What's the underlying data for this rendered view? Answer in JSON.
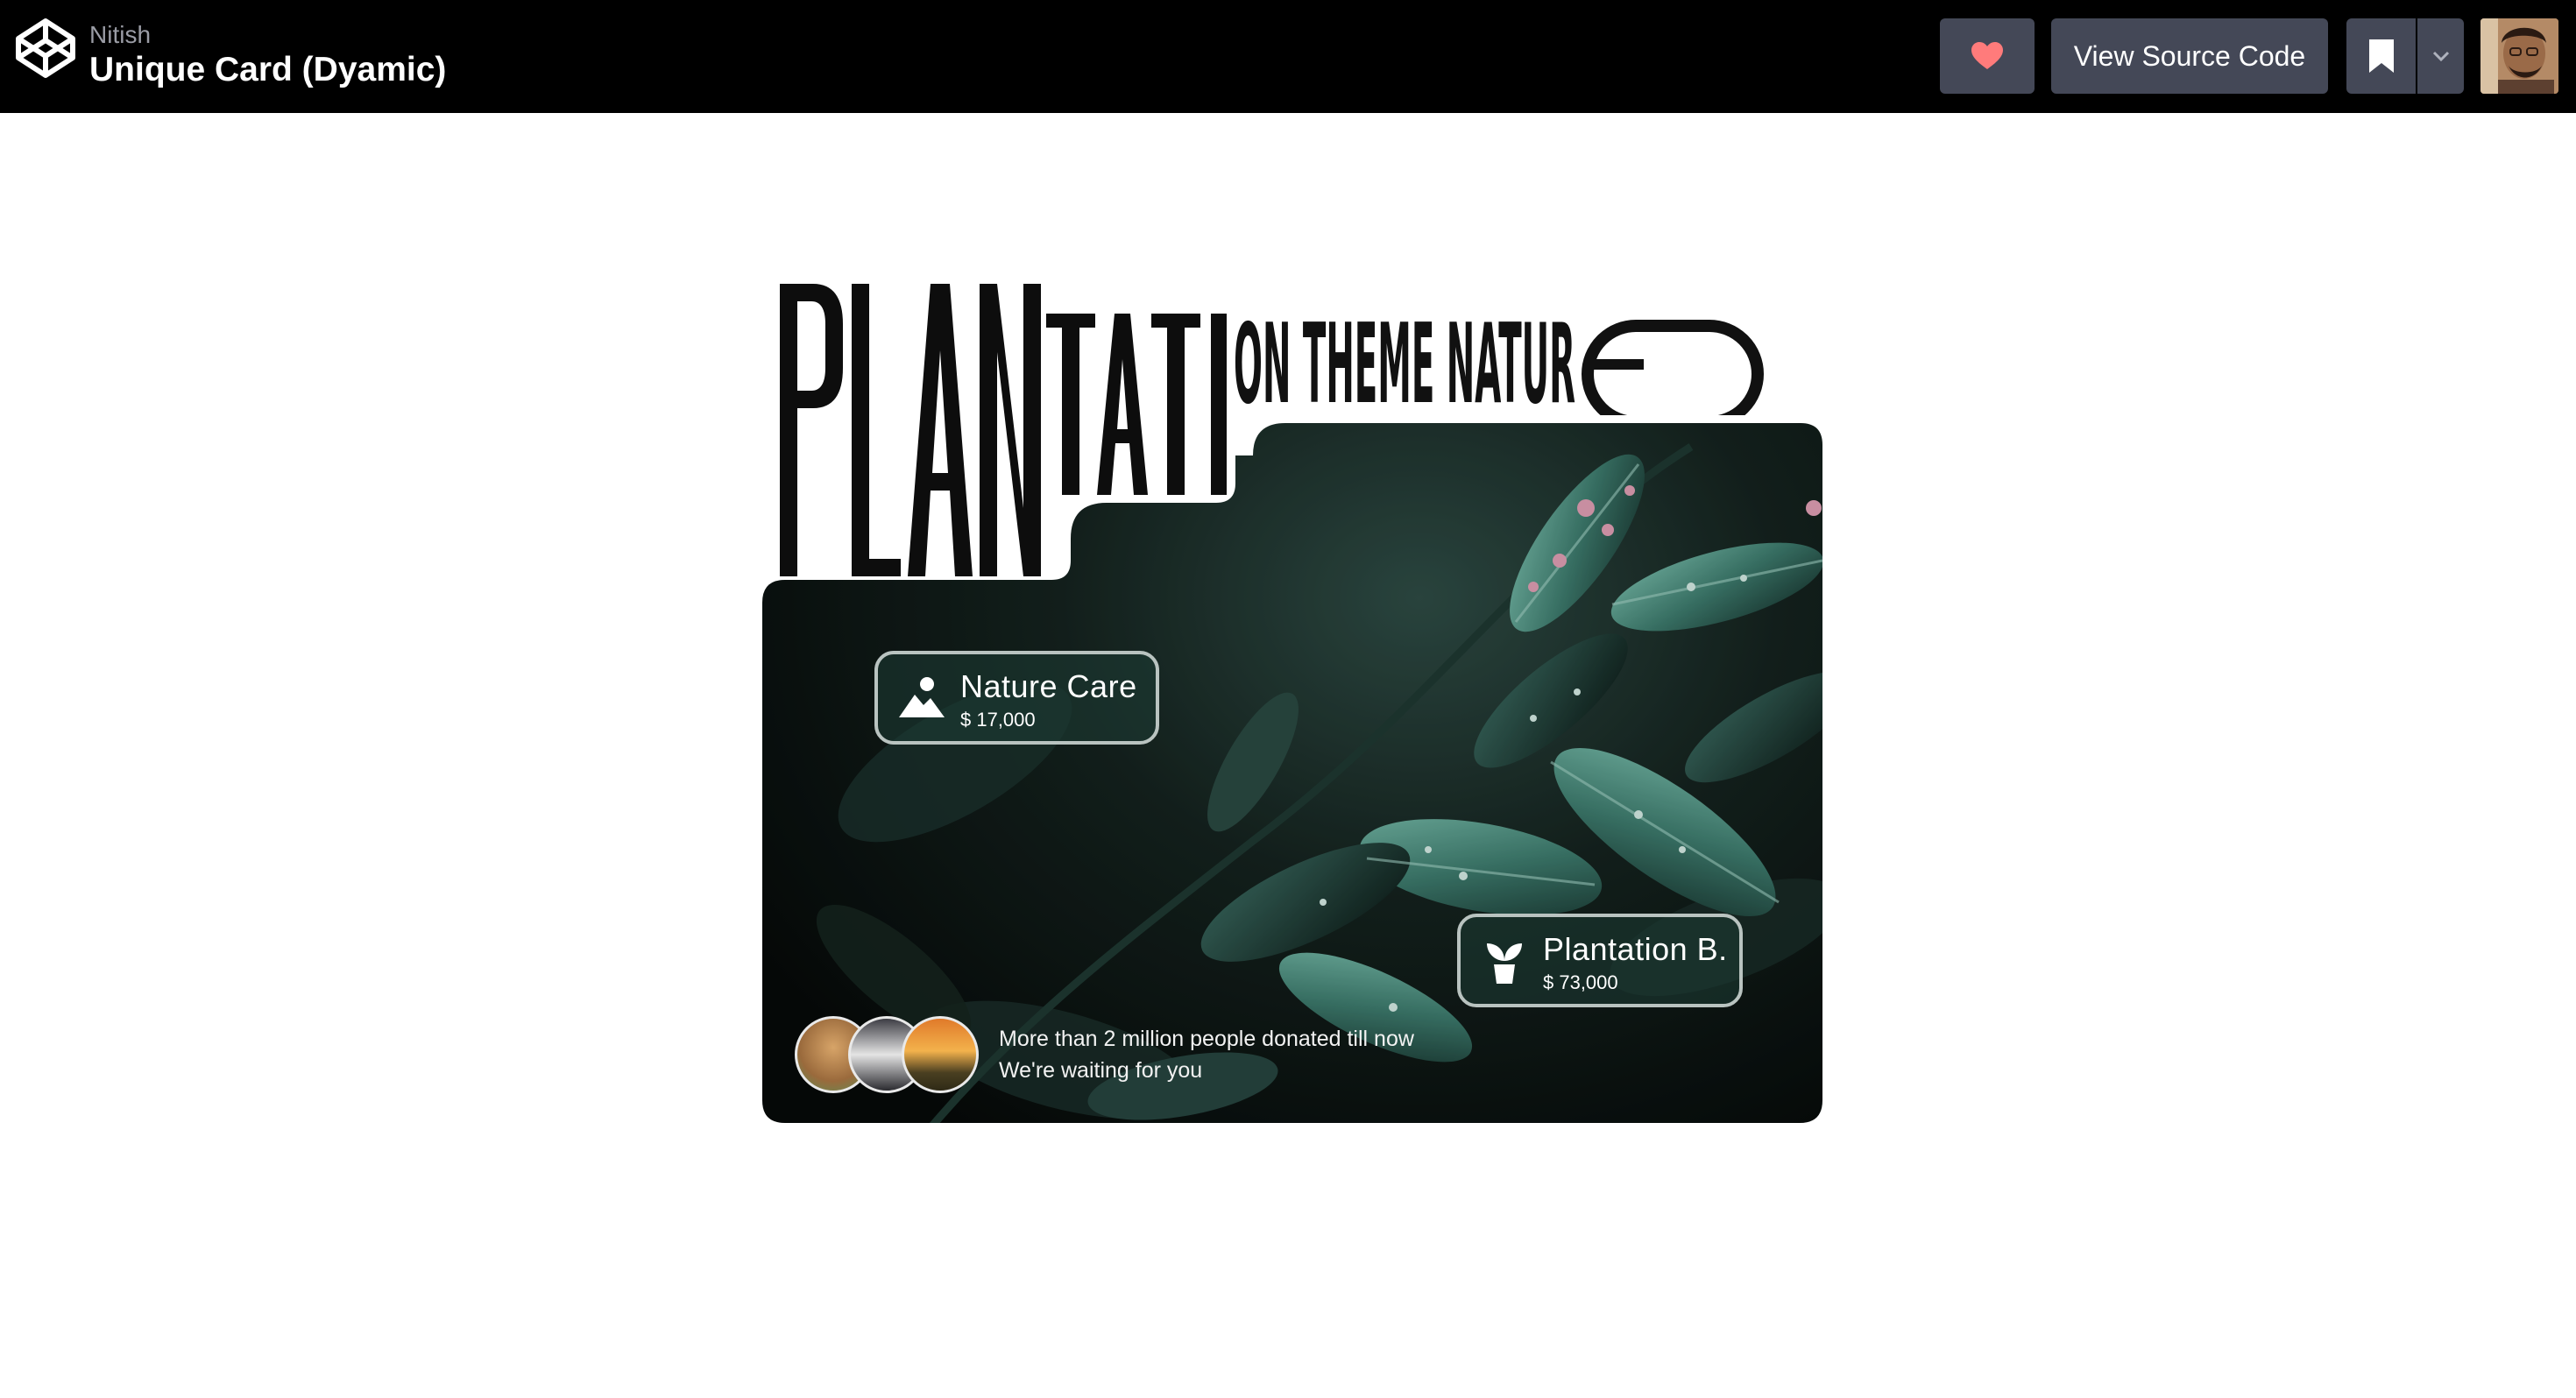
{
  "header": {
    "owner": "Nitish",
    "title": "Unique Card (Dyamic)",
    "source_button_label": "View Source Code",
    "heart_color": "#ff7b7b",
    "icons": [
      "codepen-logo-icon",
      "heart-icon",
      "bookmark-icon",
      "chevron-down-icon"
    ]
  },
  "card": {
    "heading_large": "PLANTATI",
    "heading_small": "ON THEME NATUR",
    "pills": [
      {
        "name": "Nature Care",
        "price": "$ 17,000",
        "icon": "mountain-person-icon"
      },
      {
        "name": "Plantation B.",
        "price": "$ 73,000",
        "icon": "plant-pot-icon"
      }
    ],
    "donation_line_1": "More than 2 million people donated till now",
    "donation_line_2": "We're waiting for you"
  },
  "colors": {
    "topbar_bg": "#000000",
    "button_bg": "#444857",
    "leaf_accent": "#5fa896",
    "droplet_accent": "#e4a2b8"
  }
}
